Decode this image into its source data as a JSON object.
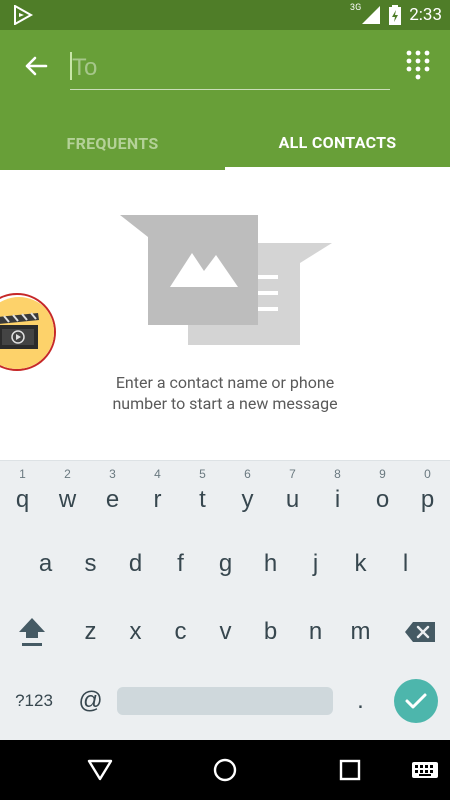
{
  "status_bar": {
    "network": "3G",
    "time": "2:33"
  },
  "toolbar": {
    "to_placeholder": "To",
    "tabs": [
      {
        "label": "FREQUENTS",
        "active": false
      },
      {
        "label": "ALL CONTACTS",
        "active": true
      }
    ]
  },
  "content": {
    "empty_message_line1": "Enter a contact name or phone",
    "empty_message_line2": "number to start a new message"
  },
  "keyboard": {
    "row1": [
      {
        "key": "q",
        "hint": "1"
      },
      {
        "key": "w",
        "hint": "2"
      },
      {
        "key": "e",
        "hint": "3"
      },
      {
        "key": "r",
        "hint": "4"
      },
      {
        "key": "t",
        "hint": "5"
      },
      {
        "key": "y",
        "hint": "6"
      },
      {
        "key": "u",
        "hint": "7"
      },
      {
        "key": "i",
        "hint": "8"
      },
      {
        "key": "o",
        "hint": "9"
      },
      {
        "key": "p",
        "hint": "0"
      }
    ],
    "row2": [
      "a",
      "s",
      "d",
      "f",
      "g",
      "h",
      "j",
      "k",
      "l"
    ],
    "row3": [
      "z",
      "x",
      "c",
      "v",
      "b",
      "n",
      "m"
    ],
    "symbols_label": "?123",
    "at_label": "@",
    "period_label": "."
  },
  "colors": {
    "status_bar": "#4f7d28",
    "toolbar": "#689f38",
    "keyboard_bg": "#eceff1",
    "enter_key": "#4db6ac"
  }
}
